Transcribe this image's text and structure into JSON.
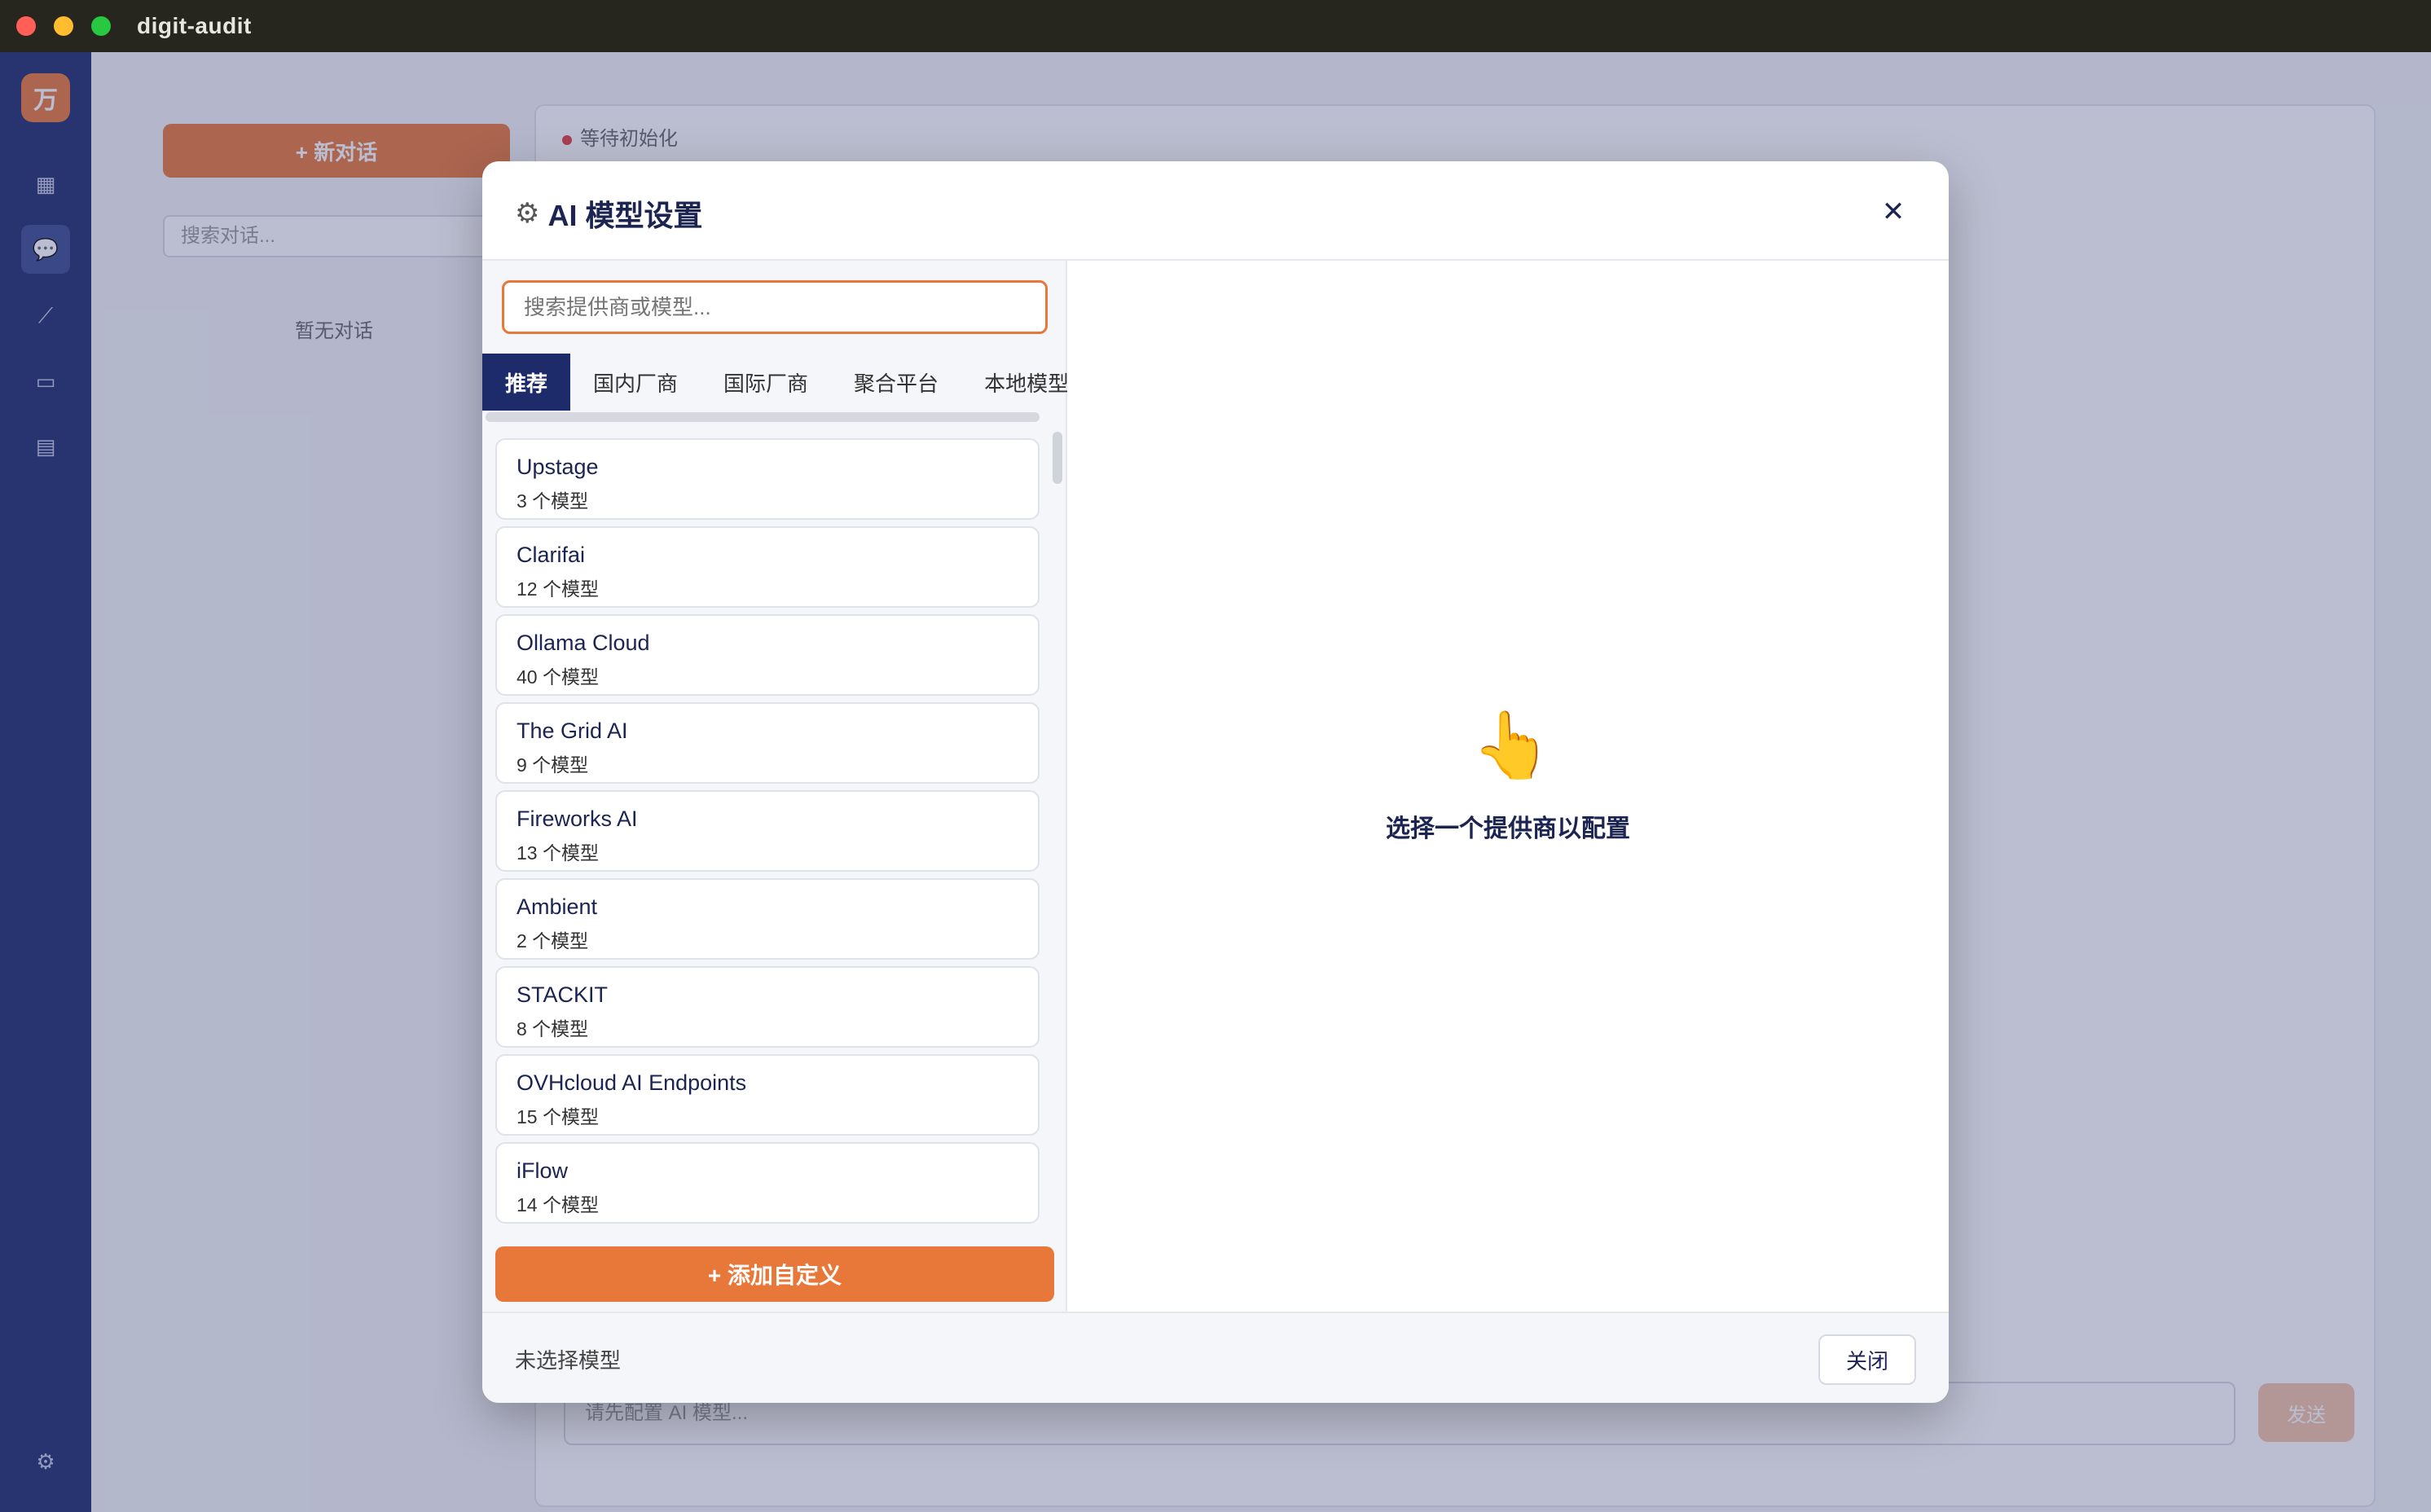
{
  "window": {
    "title": "digit-audit"
  },
  "background_app": {
    "sidebar_logo": "万",
    "new_chat_label": "+ 新对话",
    "conv_search_placeholder": "搜索对话...",
    "conv_empty": "暂无对话",
    "status_text": "等待初始化",
    "chat_input_placeholder": "请先配置 AI 模型...",
    "send_label": "发送"
  },
  "modal": {
    "title": "AI 模型设置",
    "search_placeholder": "搜索提供商或模型...",
    "tabs": [
      {
        "label": "推荐",
        "active": true
      },
      {
        "label": "国内厂商",
        "active": false
      },
      {
        "label": "国际厂商",
        "active": false
      },
      {
        "label": "聚合平台",
        "active": false
      },
      {
        "label": "本地模型",
        "active": false
      }
    ],
    "providers": [
      {
        "name": "Upstage",
        "count": "3 个模型"
      },
      {
        "name": "Clarifai",
        "count": "12 个模型"
      },
      {
        "name": "Ollama Cloud",
        "count": "40 个模型"
      },
      {
        "name": "The Grid AI",
        "count": "9 个模型"
      },
      {
        "name": "Fireworks AI",
        "count": "13 个模型"
      },
      {
        "name": "Ambient",
        "count": "2 个模型"
      },
      {
        "name": "STACKIT",
        "count": "8 个模型"
      },
      {
        "name": "OVHcloud AI Endpoints",
        "count": "15 个模型"
      },
      {
        "name": "iFlow",
        "count": "14 个模型"
      }
    ],
    "add_custom_label": "+ 添加自定义",
    "empty_hint": "选择一个提供商以配置",
    "footer_status": "未选择模型",
    "close_label": "关闭"
  },
  "colors": {
    "accent": "#e8773a",
    "navy": "#1e2b6b"
  }
}
